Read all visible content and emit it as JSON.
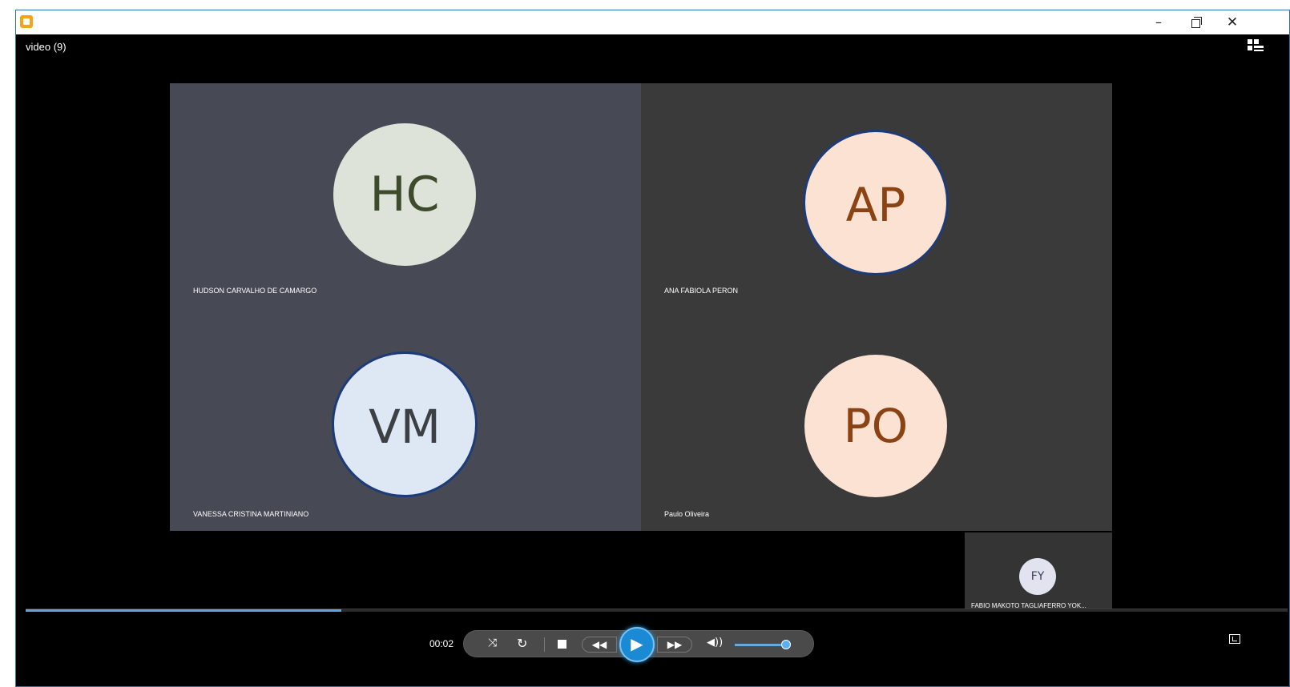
{
  "window": {
    "minimize_glyph": "–",
    "close_glyph": "✕",
    "video_title": "video (9)"
  },
  "participants": [
    {
      "initials": "HC",
      "name": "HUDSON CARVALHO DE CAMARGO",
      "avatar_bg": "#dde3d8",
      "text_color": "#3d4a2c"
    },
    {
      "initials": "AP",
      "name": "ANA FABIOLA PERON",
      "avatar_bg": "#fbe2d3",
      "text_color": "#8c4313"
    },
    {
      "initials": "VM",
      "name": "VANESSA CRISTINA MARTINIANO",
      "avatar_bg": "#dde8f4",
      "text_color": "#3c3f44"
    },
    {
      "initials": "PO",
      "name": "Paulo Oliveira",
      "avatar_bg": "#fbe2d3",
      "text_color": "#8c4313"
    },
    {
      "initials": "FY",
      "name": "FABIO MAKOTO TAGLIAFERRO YOK...",
      "avatar_bg": "#e2e3ef",
      "text_color": "#3a3d5c"
    }
  ],
  "player": {
    "timecode": "00:02",
    "progress": 0.25,
    "volume": 0.85,
    "accent_color": "#1a8ad4",
    "shuffle_glyph": "⤨",
    "repeat_glyph": "↻",
    "prev_glyph": "◀◀",
    "play_glyph": "▶",
    "next_glyph": "▶▶",
    "volume_glyph": "◀))"
  }
}
